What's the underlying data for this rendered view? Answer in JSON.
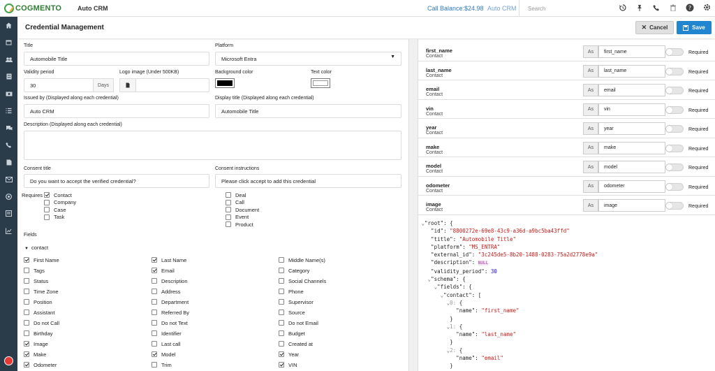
{
  "topbar": {
    "logo_text": "COGMENTO",
    "app_name": "Auto CRM",
    "call_balance": "Call Balance:$24.98",
    "company": "Auto CRM",
    "search_placeholder": "Search"
  },
  "page": {
    "title": "Credential Management",
    "cancel_label": "Cancel",
    "save_label": "Save"
  },
  "form": {
    "title_label": "Title",
    "title_value": "Automobile Title",
    "platform_label": "Platform",
    "platform_value": "Microsoft Entra",
    "validity_label": "Validity period",
    "validity_value": "30",
    "validity_unit": "Days",
    "logo_label": "Logo image (Under 500KB)",
    "bg_color_label": "Background color",
    "bg_color": "#000000",
    "text_color_label": "Text color",
    "text_color": "#ffffff",
    "issued_by_label": "Issued by (Displayed along each credential)",
    "issued_by_value": "Auto CRM",
    "display_title_label": "Display title (Displayed along each credential)",
    "display_title_value": "Automobile Title",
    "description_label": "Description (Displayed along each credential)",
    "description_value": "",
    "consent_title_label": "Consent title",
    "consent_title_value": "Do you want to accept the verified credential?",
    "consent_instr_label": "Consent instructions",
    "consent_instr_value": "Please click accept to add this credential",
    "requires_label": "Requires",
    "requires_col1": [
      {
        "label": "Contact",
        "checked": true
      },
      {
        "label": "Company",
        "checked": false
      },
      {
        "label": "Case",
        "checked": false
      },
      {
        "label": "Task",
        "checked": false
      }
    ],
    "requires_col2": [
      {
        "label": "Deal",
        "checked": false
      },
      {
        "label": "Call",
        "checked": false
      },
      {
        "label": "Document",
        "checked": false
      },
      {
        "label": "Event",
        "checked": false
      },
      {
        "label": "Product",
        "checked": false
      }
    ],
    "fields_label": "Fields",
    "contact_group_label": "contact",
    "fields_col1": [
      {
        "label": "First Name",
        "checked": true
      },
      {
        "label": "Tags",
        "checked": false
      },
      {
        "label": "Status",
        "checked": false
      },
      {
        "label": "Time Zone",
        "checked": false
      },
      {
        "label": "Position",
        "checked": false
      },
      {
        "label": "Assistant",
        "checked": false
      },
      {
        "label": "Do not Call",
        "checked": false
      },
      {
        "label": "Birthday",
        "checked": false
      },
      {
        "label": "Image",
        "checked": true
      },
      {
        "label": "Make",
        "checked": true
      },
      {
        "label": "Odometer",
        "checked": true
      }
    ],
    "fields_col2": [
      {
        "label": "Last Name",
        "checked": true
      },
      {
        "label": "Email",
        "checked": true
      },
      {
        "label": "Description",
        "checked": false
      },
      {
        "label": "Address",
        "checked": false
      },
      {
        "label": "Department",
        "checked": false
      },
      {
        "label": "Referred By",
        "checked": false
      },
      {
        "label": "Do not Text",
        "checked": false
      },
      {
        "label": "Identifier",
        "checked": false
      },
      {
        "label": "Last call",
        "checked": false
      },
      {
        "label": "Model",
        "checked": true
      },
      {
        "label": "Trim",
        "checked": false
      }
    ],
    "fields_col3": [
      {
        "label": "Middle Name(s)",
        "checked": false
      },
      {
        "label": "Category",
        "checked": false
      },
      {
        "label": "Social Channels",
        "checked": false
      },
      {
        "label": "Phone",
        "checked": false
      },
      {
        "label": "Supervisor",
        "checked": false
      },
      {
        "label": "Source",
        "checked": false
      },
      {
        "label": "Do not Email",
        "checked": false
      },
      {
        "label": "Budget",
        "checked": false
      },
      {
        "label": "Created at",
        "checked": false
      },
      {
        "label": "Year",
        "checked": true
      },
      {
        "label": "VIN",
        "checked": true
      }
    ]
  },
  "mapping": {
    "as_label": "As",
    "required_label": "Required",
    "rows": [
      {
        "name": "first_name",
        "entity": "Contact",
        "alias": "first_name"
      },
      {
        "name": "last_name",
        "entity": "Contact",
        "alias": "last_name"
      },
      {
        "name": "email",
        "entity": "Contact",
        "alias": "email"
      },
      {
        "name": "vin",
        "entity": "Contact",
        "alias": "vin"
      },
      {
        "name": "year",
        "entity": "Contact",
        "alias": "year"
      },
      {
        "name": "make",
        "entity": "Contact",
        "alias": "make"
      },
      {
        "name": "model",
        "entity": "Contact",
        "alias": "model"
      },
      {
        "name": "odometer",
        "entity": "Contact",
        "alias": "odometer"
      },
      {
        "name": "image",
        "entity": "Contact",
        "alias": "image"
      }
    ]
  },
  "json_view": {
    "id": "8800272e-69e8-43c9-a36d-a9bc5ba43ffd",
    "title": "Automobile Title",
    "platform": "MS_ENTRA",
    "external_id": "3c245de5-8b20-1488-0283-75a2d2778e9a",
    "description": "NULL",
    "validity_period": "30",
    "contact_names": [
      "first_name",
      "last_name",
      "email"
    ]
  }
}
